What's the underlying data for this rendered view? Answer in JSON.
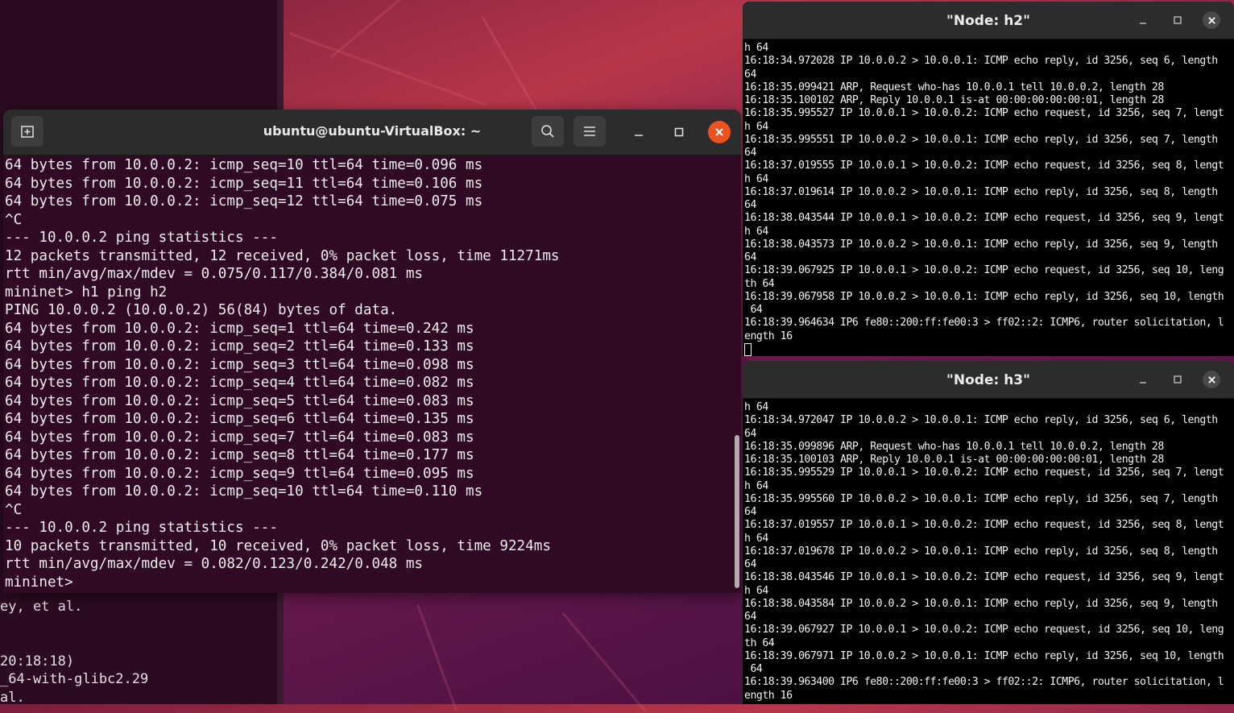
{
  "background_terminal": {
    "lines": [
      "ey, et al.",
      "",
      "",
      "20:18:18)",
      "_64-with-glibc2.29",
      "al."
    ]
  },
  "main_terminal": {
    "title": "ubuntu@ubuntu-VirtualBox: ~",
    "lines": [
      "64 bytes from 10.0.0.2: icmp_seq=10 ttl=64 time=0.096 ms",
      "64 bytes from 10.0.0.2: icmp_seq=11 ttl=64 time=0.106 ms",
      "64 bytes from 10.0.0.2: icmp_seq=12 ttl=64 time=0.075 ms",
      "^C",
      "--- 10.0.0.2 ping statistics ---",
      "12 packets transmitted, 12 received, 0% packet loss, time 11271ms",
      "rtt min/avg/max/mdev = 0.075/0.117/0.384/0.081 ms",
      "mininet> h1 ping h2",
      "PING 10.0.0.2 (10.0.0.2) 56(84) bytes of data.",
      "64 bytes from 10.0.0.2: icmp_seq=1 ttl=64 time=0.242 ms",
      "64 bytes from 10.0.0.2: icmp_seq=2 ttl=64 time=0.133 ms",
      "64 bytes from 10.0.0.2: icmp_seq=3 ttl=64 time=0.098 ms",
      "64 bytes from 10.0.0.2: icmp_seq=4 ttl=64 time=0.082 ms",
      "64 bytes from 10.0.0.2: icmp_seq=5 ttl=64 time=0.083 ms",
      "64 bytes from 10.0.0.2: icmp_seq=6 ttl=64 time=0.135 ms",
      "64 bytes from 10.0.0.2: icmp_seq=7 ttl=64 time=0.083 ms",
      "64 bytes from 10.0.0.2: icmp_seq=8 ttl=64 time=0.177 ms",
      "64 bytes from 10.0.0.2: icmp_seq=9 ttl=64 time=0.095 ms",
      "64 bytes from 10.0.0.2: icmp_seq=10 ttl=64 time=0.110 ms",
      "^C",
      "--- 10.0.0.2 ping statistics ---",
      "10 packets transmitted, 10 received, 0% packet loss, time 9224ms",
      "rtt min/avg/max/mdev = 0.082/0.123/0.242/0.048 ms",
      "mininet> "
    ]
  },
  "node_h2": {
    "title": "\"Node: h2\"",
    "lines": [
      "h 64",
      "16:18:34.972028 IP 10.0.0.2 > 10.0.0.1: ICMP echo reply, id 3256, seq 6, length",
      "64",
      "16:18:35.099421 ARP, Request who-has 10.0.0.1 tell 10.0.0.2, length 28",
      "16:18:35.100102 ARP, Reply 10.0.0.1 is-at 00:00:00:00:00:01, length 28",
      "16:18:35.995527 IP 10.0.0.1 > 10.0.0.2: ICMP echo request, id 3256, seq 7, lengt",
      "h 64",
      "16:18:35.995551 IP 10.0.0.2 > 10.0.0.1: ICMP echo reply, id 3256, seq 7, length",
      "64",
      "16:18:37.019555 IP 10.0.0.1 > 10.0.0.2: ICMP echo request, id 3256, seq 8, lengt",
      "h 64",
      "16:18:37.019614 IP 10.0.0.2 > 10.0.0.1: ICMP echo reply, id 3256, seq 8, length",
      "64",
      "16:18:38.043544 IP 10.0.0.1 > 10.0.0.2: ICMP echo request, id 3256, seq 9, lengt",
      "h 64",
      "16:18:38.043573 IP 10.0.0.2 > 10.0.0.1: ICMP echo reply, id 3256, seq 9, length",
      "64",
      "16:18:39.067925 IP 10.0.0.1 > 10.0.0.2: ICMP echo request, id 3256, seq 10, leng",
      "th 64",
      "16:18:39.067958 IP 10.0.0.2 > 10.0.0.1: ICMP echo reply, id 3256, seq 10, length",
      " 64",
      "16:18:39.964634 IP6 fe80::200:ff:fe00:3 > ff02::2: ICMP6, router solicitation, l",
      "ength 16"
    ]
  },
  "node_h3": {
    "title": "\"Node: h3\"",
    "lines": [
      "h 64",
      "16:18:34.972047 IP 10.0.0.2 > 10.0.0.1: ICMP echo reply, id 3256, seq 6, length",
      "64",
      "16:18:35.099896 ARP, Request who-has 10.0.0.1 tell 10.0.0.2, length 28",
      "16:18:35.100103 ARP, Reply 10.0.0.1 is-at 00:00:00:00:00:01, length 28",
      "16:18:35.995529 IP 10.0.0.1 > 10.0.0.2: ICMP echo request, id 3256, seq 7, lengt",
      "h 64",
      "16:18:35.995560 IP 10.0.0.2 > 10.0.0.1: ICMP echo reply, id 3256, seq 7, length",
      "64",
      "16:18:37.019557 IP 10.0.0.1 > 10.0.0.2: ICMP echo request, id 3256, seq 8, lengt",
      "h 64",
      "16:18:37.019678 IP 10.0.0.2 > 10.0.0.1: ICMP echo reply, id 3256, seq 8, length",
      "64",
      "16:18:38.043546 IP 10.0.0.1 > 10.0.0.2: ICMP echo request, id 3256, seq 9, lengt",
      "h 64",
      "16:18:38.043584 IP 10.0.0.2 > 10.0.0.1: ICMP echo reply, id 3256, seq 9, length",
      "64",
      "16:18:39.067927 IP 10.0.0.1 > 10.0.0.2: ICMP echo request, id 3256, seq 10, leng",
      "th 64",
      "16:18:39.067971 IP 10.0.0.2 > 10.0.0.1: ICMP echo reply, id 3256, seq 10, length",
      " 64",
      "16:18:39.963400 IP6 fe80::200:ff:fe00:3 > ff02::2: ICMP6, router solicitation, l",
      "ength 16"
    ]
  },
  "icons": {
    "new_tab": "new-tab-icon",
    "search": "search-icon",
    "menu": "hamburger-menu-icon",
    "minimize": "minimize-icon",
    "maximize": "maximize-icon",
    "close": "close-icon"
  },
  "colors": {
    "terminal_bg": "#300a24",
    "close_accent": "#e95420",
    "titlebar": "#2c2c2c",
    "xterm_bg": "#000000"
  }
}
